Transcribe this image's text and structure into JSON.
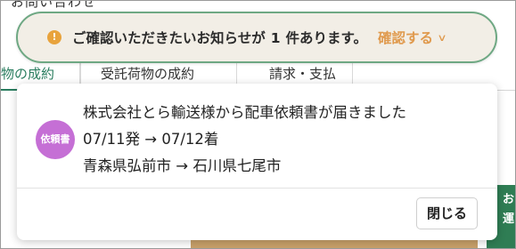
{
  "background": {
    "top_text": "お問い合わせ",
    "tabs": [
      {
        "label": "荷物の成約",
        "active": true
      },
      {
        "label": "受託荷物の成約",
        "active": false
      },
      {
        "label": "請求・支払",
        "active": false
      }
    ],
    "side_button_label": "お運"
  },
  "notice": {
    "icon_glyph": "!",
    "text_before": "ご確認いただきたいお知らせが",
    "count": "1",
    "text_after": "件あります。",
    "confirm_label": "確認する",
    "chevron": "∨"
  },
  "notification": {
    "badge_label": "依頼書",
    "badge_color": "#c56fd5",
    "title": "株式会社とら輸送様から配車依頼書が届きました",
    "schedule": "07/11発 → 07/12着",
    "route": "青森県弘前市 → 石川県七尾市",
    "close_label": "閉じる"
  },
  "colors": {
    "accent_green": "#2a7d5f",
    "pill_border": "#6ea883",
    "confirm_orange": "#e09a4e",
    "info_icon": "#e8a33d"
  }
}
